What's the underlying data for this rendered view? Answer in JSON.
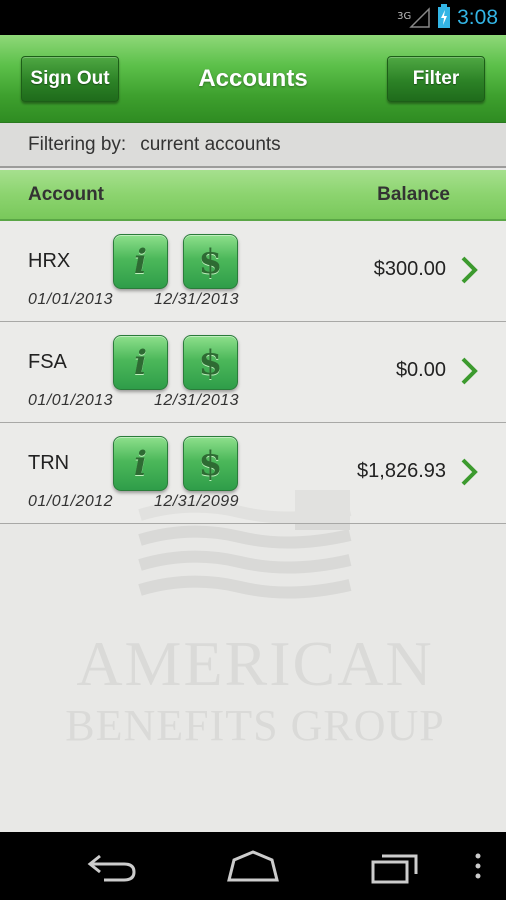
{
  "status_bar": {
    "network": "3G",
    "time": "3:08"
  },
  "action_bar": {
    "sign_out_label": "Sign Out",
    "title": "Accounts",
    "filter_label": "Filter"
  },
  "filter": {
    "label": "Filtering by:",
    "value": "current accounts"
  },
  "columns": {
    "account": "Account",
    "balance": "Balance"
  },
  "accounts": [
    {
      "code": "HRX",
      "start": "01/01/2013",
      "end": "12/31/2013",
      "balance": "$300.00",
      "info_icon": "i",
      "money_icon": "$"
    },
    {
      "code": "FSA",
      "start": "01/01/2013",
      "end": "12/31/2013",
      "balance": "$0.00",
      "info_icon": "i",
      "money_icon": "$"
    },
    {
      "code": "TRN",
      "start": "01/01/2012",
      "end": "12/31/2099",
      "balance": "$1,826.93",
      "info_icon": "i",
      "money_icon": "$"
    }
  ],
  "watermark": {
    "line1": "AMERICAN",
    "line2": "BENEFITS GROUP"
  },
  "colors": {
    "accent": "#3ea02e",
    "clock": "#33b5e5",
    "chevron": "#3c9a2e"
  }
}
